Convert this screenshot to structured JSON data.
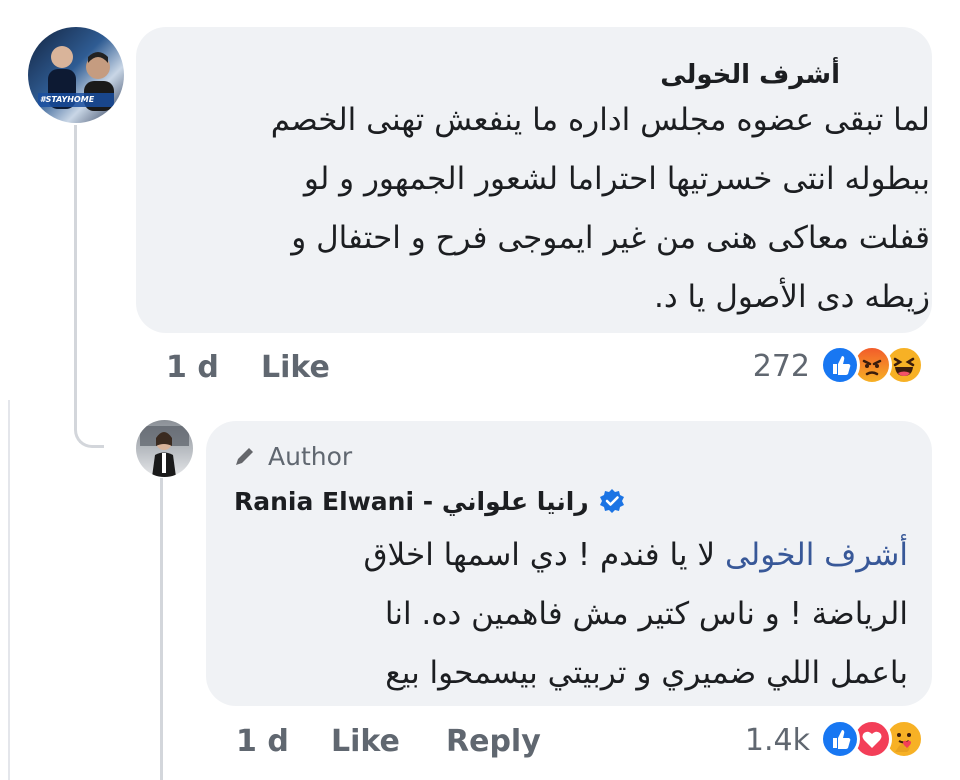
{
  "comment": {
    "author_name": "أشرف الخولى",
    "avatar_badge": "#STAYHOME",
    "lines": [
      "لما تبقى عضوه مجلس اداره ما ينفعش تهنى الخصم",
      "ببطوله انتى خسرتيها احتراما لشعور الجمهور و لو",
      "قفلت معاكى هنى من غير ايموجى فرح و احتفال و",
      "زيطه دى الأصول يا د."
    ],
    "time": "1 d",
    "like_label": "Like",
    "reaction_count": "272",
    "reactions": [
      "like-icon",
      "angry-icon",
      "haha-icon"
    ]
  },
  "reply": {
    "author_badge": "Author",
    "author_name": "Rania Elwani - رانيا علواني",
    "mention": "أشرف الخولى",
    "first_line_rest": " لا يا فندم ! دي اسمها اخلاق",
    "lines": [
      "الرياضة ! و ناس كتير مش فاهمين ده. انا",
      "باعمل اللي ضميري و تربيتي بيسمحوا بيع"
    ],
    "time": "1 d",
    "like_label": "Like",
    "reply_label": "Reply",
    "reaction_count": "1.4k",
    "reactions": [
      "like-icon",
      "love-icon",
      "care-icon"
    ]
  },
  "colors": {
    "bubble": "#f0f2f5",
    "like_blue": "#1877f2",
    "love_red": "#f33e58",
    "emoji_yellow": "#f7b125",
    "verified_blue": "#1b74e4"
  }
}
